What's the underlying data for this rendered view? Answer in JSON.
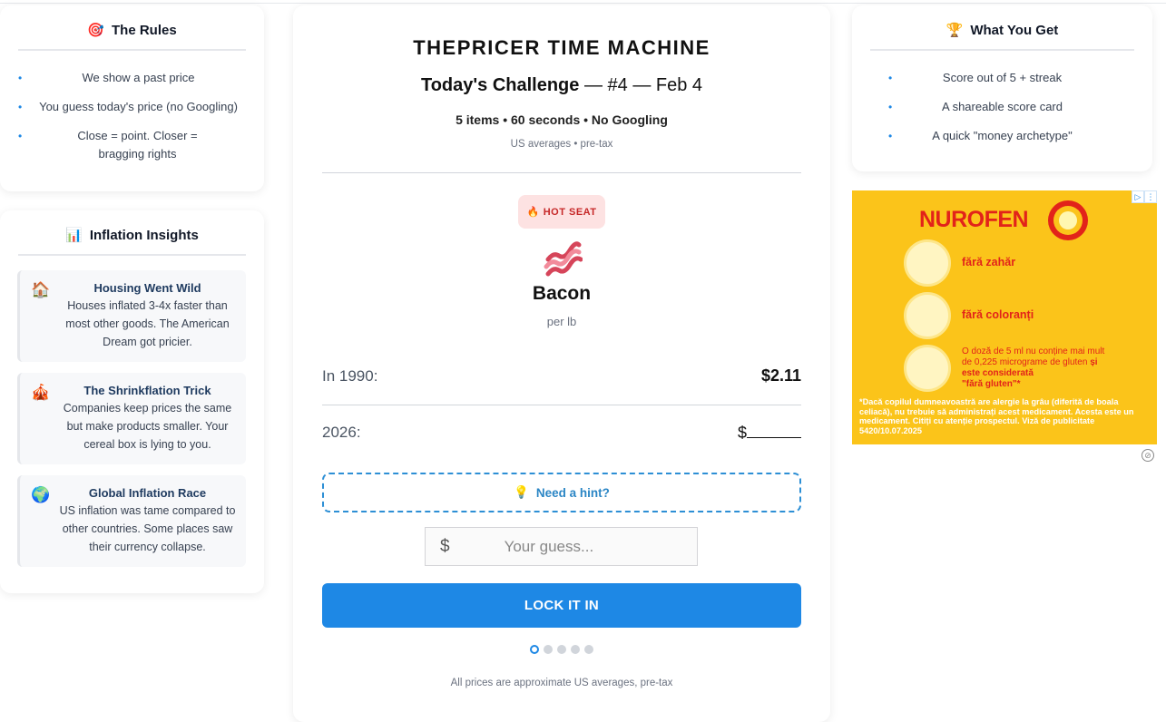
{
  "rules": {
    "icon": "🎯",
    "title": "The Rules",
    "items": [
      "We show a past price",
      "You guess today's price (no Googling)",
      "Close = point. Closer = bragging rights"
    ]
  },
  "insights": {
    "icon": "📊",
    "title": "Inflation Insights",
    "cards": [
      {
        "icon": "🏠",
        "title": "Housing Went Wild",
        "text": "Houses inflated 3-4x faster than most other goods. The American Dream got pricier."
      },
      {
        "icon": "🎪",
        "title": "The Shrinkflation Trick",
        "text": "Companies keep prices the same but make products smaller. Your cereal box is lying to you."
      },
      {
        "icon": "🌍",
        "title": "Global Inflation Race",
        "text": "US inflation was tame compared to other countries. Some places saw their currency collapse."
      }
    ]
  },
  "main": {
    "brand": "THEPRICER TIME MACHINE",
    "challenge_bold": "Today's Challenge",
    "challenge_rest": " — #4 — Feb 4",
    "meta": "5 items • 60 seconds • No Googling",
    "note": "US averages • pre-tax",
    "badge_icon": "🔥",
    "badge": "HOT SEAT",
    "item_icon": "bacon-icon",
    "item_name": "Bacon",
    "item_unit": "per lb",
    "past_label": "In 1990:",
    "past_price": "$2.11",
    "now_label": "2026:",
    "now_prefix": "$",
    "hint_icon": "💡",
    "hint": "Need a hint?",
    "guess_prefix": "$",
    "guess_placeholder": "Your guess...",
    "lock_button": "LOCK IT IN",
    "progress_current": 1,
    "progress_total": 5,
    "footer": "All prices are approximate US averages, pre-tax"
  },
  "get": {
    "icon": "🏆",
    "title": "What You Get",
    "items": [
      "Score out of 5 + streak",
      "A shareable score card",
      "A quick \"money archetype\""
    ]
  },
  "ad": {
    "brand": "NUROFEN",
    "line1": "fără zahăr",
    "line2": "fără coloranți",
    "small": "O doză de 5 ml nu conține mai mult de 0,225 micrograme de gluten",
    "small_bold": " și este considerată",
    "small_bold2": "\"fără gluten\"*",
    "fine": "*Dacă copilul dumneavoastră are alergie la grâu (diferită de boala celiacă), nu trebuie să administrați acest medicament. Acesta este un medicament. Citiți cu atenție prospectul. Viză de publicitate 5420/10.07.2025",
    "colors": {
      "bg": "#fbc41a",
      "brand": "#e2231a"
    }
  }
}
